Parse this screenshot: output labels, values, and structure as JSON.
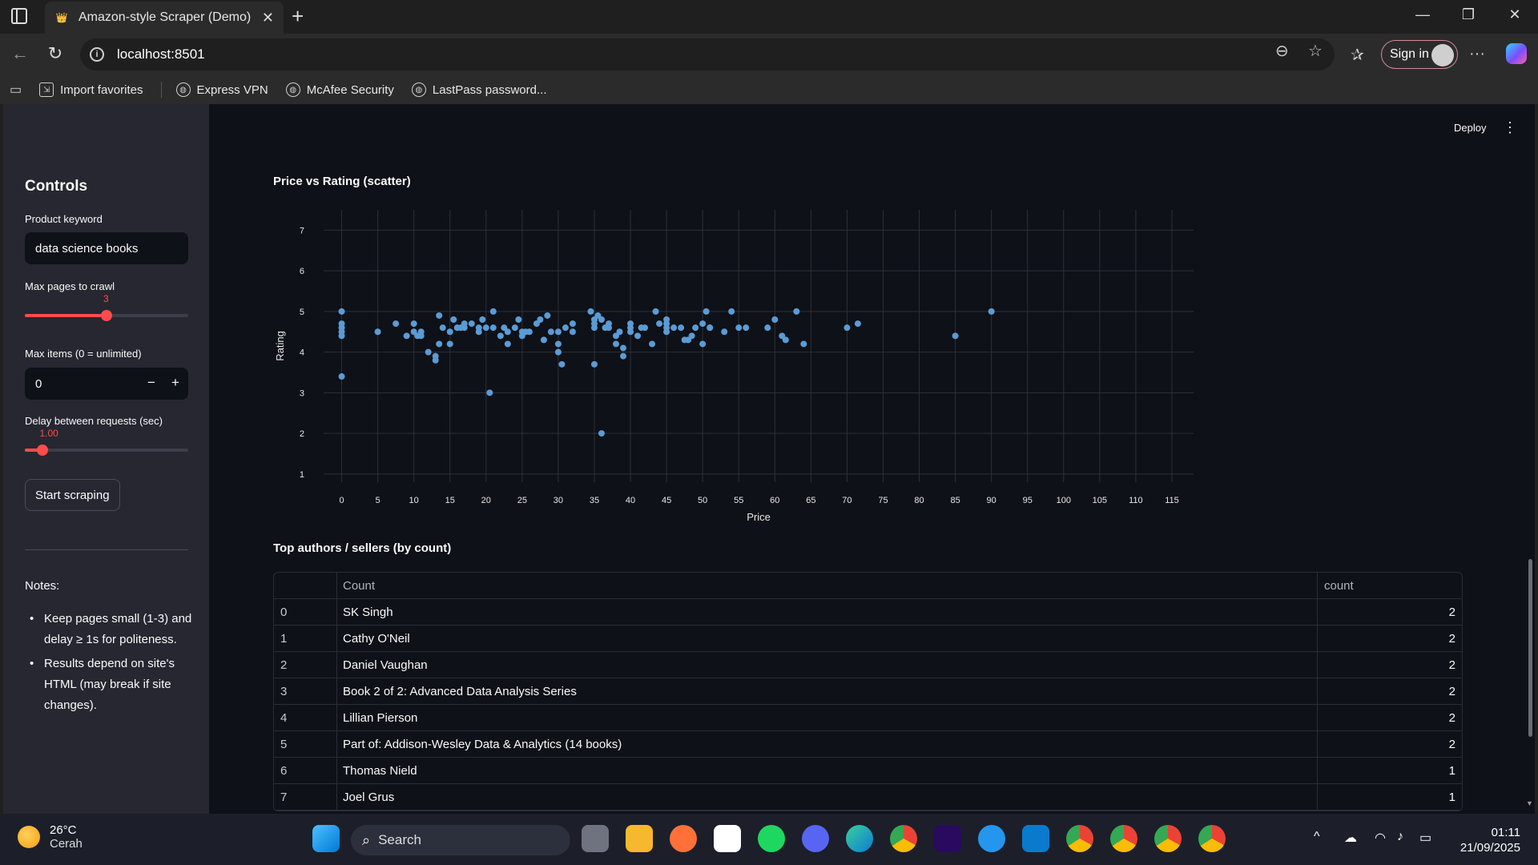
{
  "browser": {
    "tab_title": "Amazon-style Scraper (Demo)",
    "url": "localhost:8501",
    "signin_label": "Sign in",
    "favorites": [
      {
        "label": "Import favorites"
      },
      {
        "label": "Express VPN"
      },
      {
        "label": "McAfee Security"
      },
      {
        "label": "LastPass password..."
      }
    ]
  },
  "app": {
    "deploy_label": "Deploy"
  },
  "sidebar": {
    "title": "Controls",
    "keyword_label": "Product keyword",
    "keyword_value": "data science books",
    "max_pages_label": "Max pages to crawl",
    "max_pages_value": "3",
    "max_pages_fraction": 0.5,
    "max_items_label": "Max items (0 = unlimited)",
    "max_items_value": "0",
    "minus_label": "−",
    "plus_label": "+",
    "delay_label": "Delay between requests (sec)",
    "delay_value": "1.00",
    "delay_fraction": 0.11,
    "start_button": "Start scraping",
    "notes_title": "Notes:",
    "notes": [
      "Keep pages small (1-3) and delay ≥ 1s for politeness.",
      "Results depend on site's HTML (may break if site changes)."
    ]
  },
  "scatter_title": "Price vs Rating (scatter)",
  "chart_data": {
    "type": "scatter",
    "title": "Price vs Rating (scatter)",
    "xlabel": "Price",
    "ylabel": "Rating",
    "xlim": [
      -2.5,
      118
    ],
    "ylim": [
      0.8,
      7.5
    ],
    "xticks": [
      0,
      5,
      10,
      15,
      20,
      25,
      30,
      35,
      40,
      45,
      50,
      55,
      60,
      65,
      70,
      75,
      80,
      85,
      90,
      95,
      100,
      105,
      110,
      115
    ],
    "yticks": [
      1,
      2,
      3,
      4,
      5,
      6,
      7
    ],
    "point_color": "#5b9bd5",
    "x": [
      0,
      0,
      0,
      0,
      0,
      0,
      0,
      5,
      7.5,
      9,
      10,
      10,
      10.5,
      11,
      11,
      12,
      13,
      13,
      13.5,
      13.5,
      14,
      15,
      15,
      15.5,
      16,
      16.5,
      17,
      17,
      18,
      19,
      19,
      19.5,
      20,
      20.5,
      21,
      21,
      22,
      22.5,
      23,
      23,
      24,
      24.5,
      25,
      25,
      25.5,
      26,
      27,
      27.5,
      28,
      28.5,
      29,
      30,
      30,
      30,
      30.5,
      31,
      32,
      32,
      34.5,
      35,
      35,
      35,
      35,
      35.5,
      36,
      36,
      36.5,
      37,
      37,
      38,
      38,
      38.5,
      39,
      39,
      40,
      40,
      40,
      41,
      41.5,
      42,
      43,
      43.5,
      44,
      45,
      45,
      45,
      45,
      46,
      47,
      47.5,
      48,
      48.5,
      49,
      50,
      50,
      50.5,
      51,
      51,
      53,
      54,
      55,
      56,
      59,
      60,
      61,
      61.5,
      63,
      64,
      70,
      71.5,
      85,
      90
    ],
    "y": [
      5,
      4.7,
      4.6,
      4.5,
      4.4,
      3.4,
      4.6,
      4.5,
      4.7,
      4.4,
      4.7,
      4.5,
      4.4,
      4.5,
      4.4,
      4,
      3.8,
      3.9,
      4.2,
      4.9,
      4.6,
      4.5,
      4.2,
      4.8,
      4.6,
      4.6,
      4.6,
      4.7,
      4.7,
      4.5,
      4.6,
      4.8,
      4.6,
      3,
      4.6,
      5,
      4.4,
      4.6,
      4.5,
      4.2,
      4.6,
      4.8,
      4.5,
      4.4,
      4.5,
      4.5,
      4.7,
      4.8,
      4.3,
      4.9,
      4.5,
      4.5,
      4.2,
      4.0,
      3.7,
      4.6,
      4.5,
      4.7,
      5,
      4.6,
      4.7,
      4.8,
      3.7,
      4.9,
      2,
      4.8,
      4.6,
      4.7,
      4.6,
      4.2,
      4.4,
      4.5,
      4.1,
      3.9,
      4.5,
      4.6,
      4.7,
      4.4,
      4.6,
      4.6,
      4.2,
      5.0,
      4.7,
      4.5,
      4.6,
      4.8,
      4.7,
      4.6,
      4.6,
      4.3,
      4.3,
      4.4,
      4.6,
      4.2,
      4.7,
      5,
      4.6,
      4.6,
      4.5,
      5,
      4.6,
      4.6,
      4.6,
      4.8,
      4.4,
      4.3,
      5,
      4.2,
      4.6,
      4.7,
      4.4,
      5,
      5,
      4.7,
      5
    ]
  },
  "table_title": "Top authors / sellers (by count)",
  "table": {
    "headers": [
      "",
      "Count",
      "count"
    ],
    "rows": [
      {
        "idx": "0",
        "name": "SK Singh",
        "count": "2"
      },
      {
        "idx": "1",
        "name": "Cathy O'Neil",
        "count": "2"
      },
      {
        "idx": "2",
        "name": "Daniel Vaughan",
        "count": "2"
      },
      {
        "idx": "3",
        "name": "Book 2 of 2: Advanced Data Analysis Series",
        "count": "2"
      },
      {
        "idx": "4",
        "name": "Lillian Pierson",
        "count": "2"
      },
      {
        "idx": "5",
        "name": "Part of: Addison-Wesley Data & Analytics (14 books)",
        "count": "2"
      },
      {
        "idx": "6",
        "name": "Thomas Nield",
        "count": "1"
      },
      {
        "idx": "7",
        "name": "Joel Grus",
        "count": "1"
      }
    ]
  },
  "taskbar": {
    "temp": "26°C",
    "weather": "Cerah",
    "search_label": "Search",
    "time": "01:11",
    "date": "21/09/2025"
  }
}
